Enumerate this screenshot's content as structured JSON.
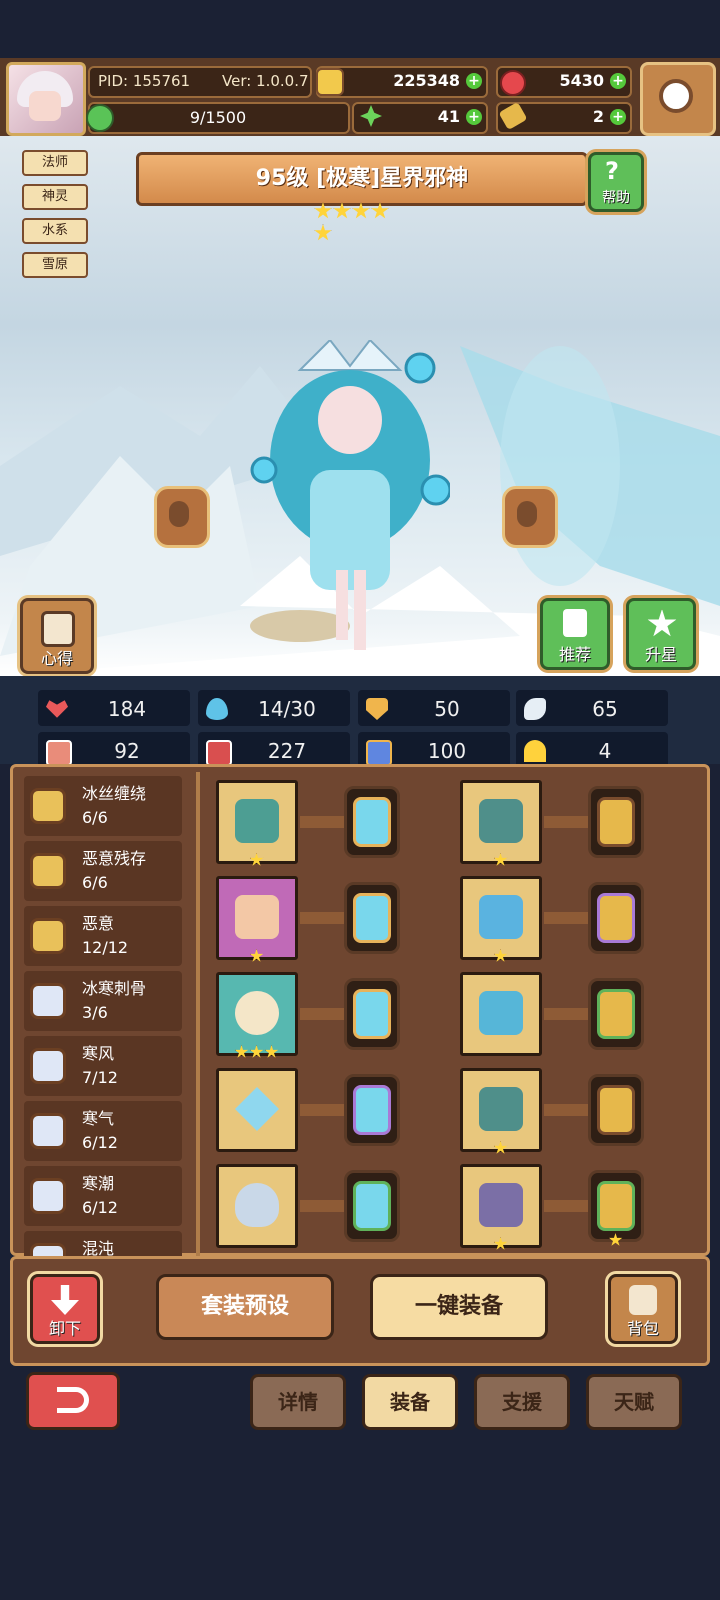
{
  "topbar": {
    "pid": "PID: 155761",
    "version": "Ver: 1.0.0.7",
    "gold": "225348",
    "gems": "5430",
    "energy": "9/1500",
    "clover": "41",
    "keys": "2"
  },
  "tags": [
    "法师",
    "神灵",
    "水系",
    "雪原"
  ],
  "hero": {
    "title": "95级  [极寒]星界邪神",
    "stars": 5,
    "help_label": "帮助",
    "insight_label": "心得",
    "recommend_label": "推荐",
    "star_up_label": "升星"
  },
  "stats": [
    {
      "icon": "heart-icon",
      "value": "184",
      "color": "#e9595a"
    },
    {
      "icon": "water-drop-icon",
      "value": "14/30",
      "color": "#5fc3e8"
    },
    {
      "icon": "shield-icon",
      "value": "50",
      "color": "#f0b54c"
    },
    {
      "icon": "wing-icon",
      "value": "65",
      "color": "#e6eef5"
    },
    {
      "icon": "fist-icon",
      "value": "92",
      "color": "#e98c7a"
    },
    {
      "icon": "book-icon",
      "value": "227",
      "color": "#d94f4f"
    },
    {
      "icon": "boot-icon",
      "value": "100",
      "color": "#5f86e0"
    },
    {
      "icon": "horseshoe-icon",
      "value": "4",
      "color": "#ffd23c"
    }
  ],
  "sets": [
    {
      "name": "冰丝缠绕",
      "count": "6/6",
      "type": "gold"
    },
    {
      "name": "恶意残存",
      "count": "6/6",
      "type": "gold"
    },
    {
      "name": "恶意",
      "count": "12/12",
      "type": "gold"
    },
    {
      "name": "冰寒刺骨",
      "count": "3/6",
      "type": "ice"
    },
    {
      "name": "寒风",
      "count": "7/12",
      "type": "ice"
    },
    {
      "name": "寒气",
      "count": "6/12",
      "type": "ice"
    },
    {
      "name": "寒潮",
      "count": "6/12",
      "type": "ice"
    },
    {
      "name": "混沌",
      "count": "",
      "type": "ice"
    }
  ],
  "equipment_left": [
    {
      "item": "staff-icon",
      "bg": "gold",
      "stars": 1,
      "gem_stars": 1
    },
    {
      "item": "hat-icon",
      "bg": "purple",
      "stars": 1,
      "gem_stars": 1
    },
    {
      "item": "necklace-icon",
      "bg": "teal",
      "stars": 3,
      "gem_stars": 0
    },
    {
      "item": "crystal-icon",
      "bg": "gold",
      "stars": 0,
      "gem_stars": 1
    },
    {
      "item": "ring-icon",
      "bg": "gold",
      "stars": 0,
      "gem_stars": 2
    }
  ],
  "equipment_right": [
    {
      "item": "armor-icon",
      "bg": "gold",
      "stars": 1,
      "rune_stars": 0
    },
    {
      "item": "robe-icon",
      "bg": "gold",
      "stars": 1,
      "rune_stars": 0
    },
    {
      "item": "cape-icon",
      "bg": "gold",
      "stars": 0,
      "rune_stars": 0
    },
    {
      "item": "belt-icon",
      "bg": "gold",
      "stars": 1,
      "rune_stars": 0
    },
    {
      "item": "boots-icon",
      "bg": "gold",
      "stars": 1,
      "rune_stars": 1
    }
  ],
  "controls": {
    "unequip_label": "卸下",
    "preset_label": "套装预设",
    "auto_equip_label": "一键装备",
    "bag_label": "背包"
  },
  "tabs": [
    {
      "label": "详情",
      "active": false
    },
    {
      "label": "装备",
      "active": true
    },
    {
      "label": "支援",
      "active": false
    },
    {
      "label": "天赋",
      "active": false
    }
  ]
}
